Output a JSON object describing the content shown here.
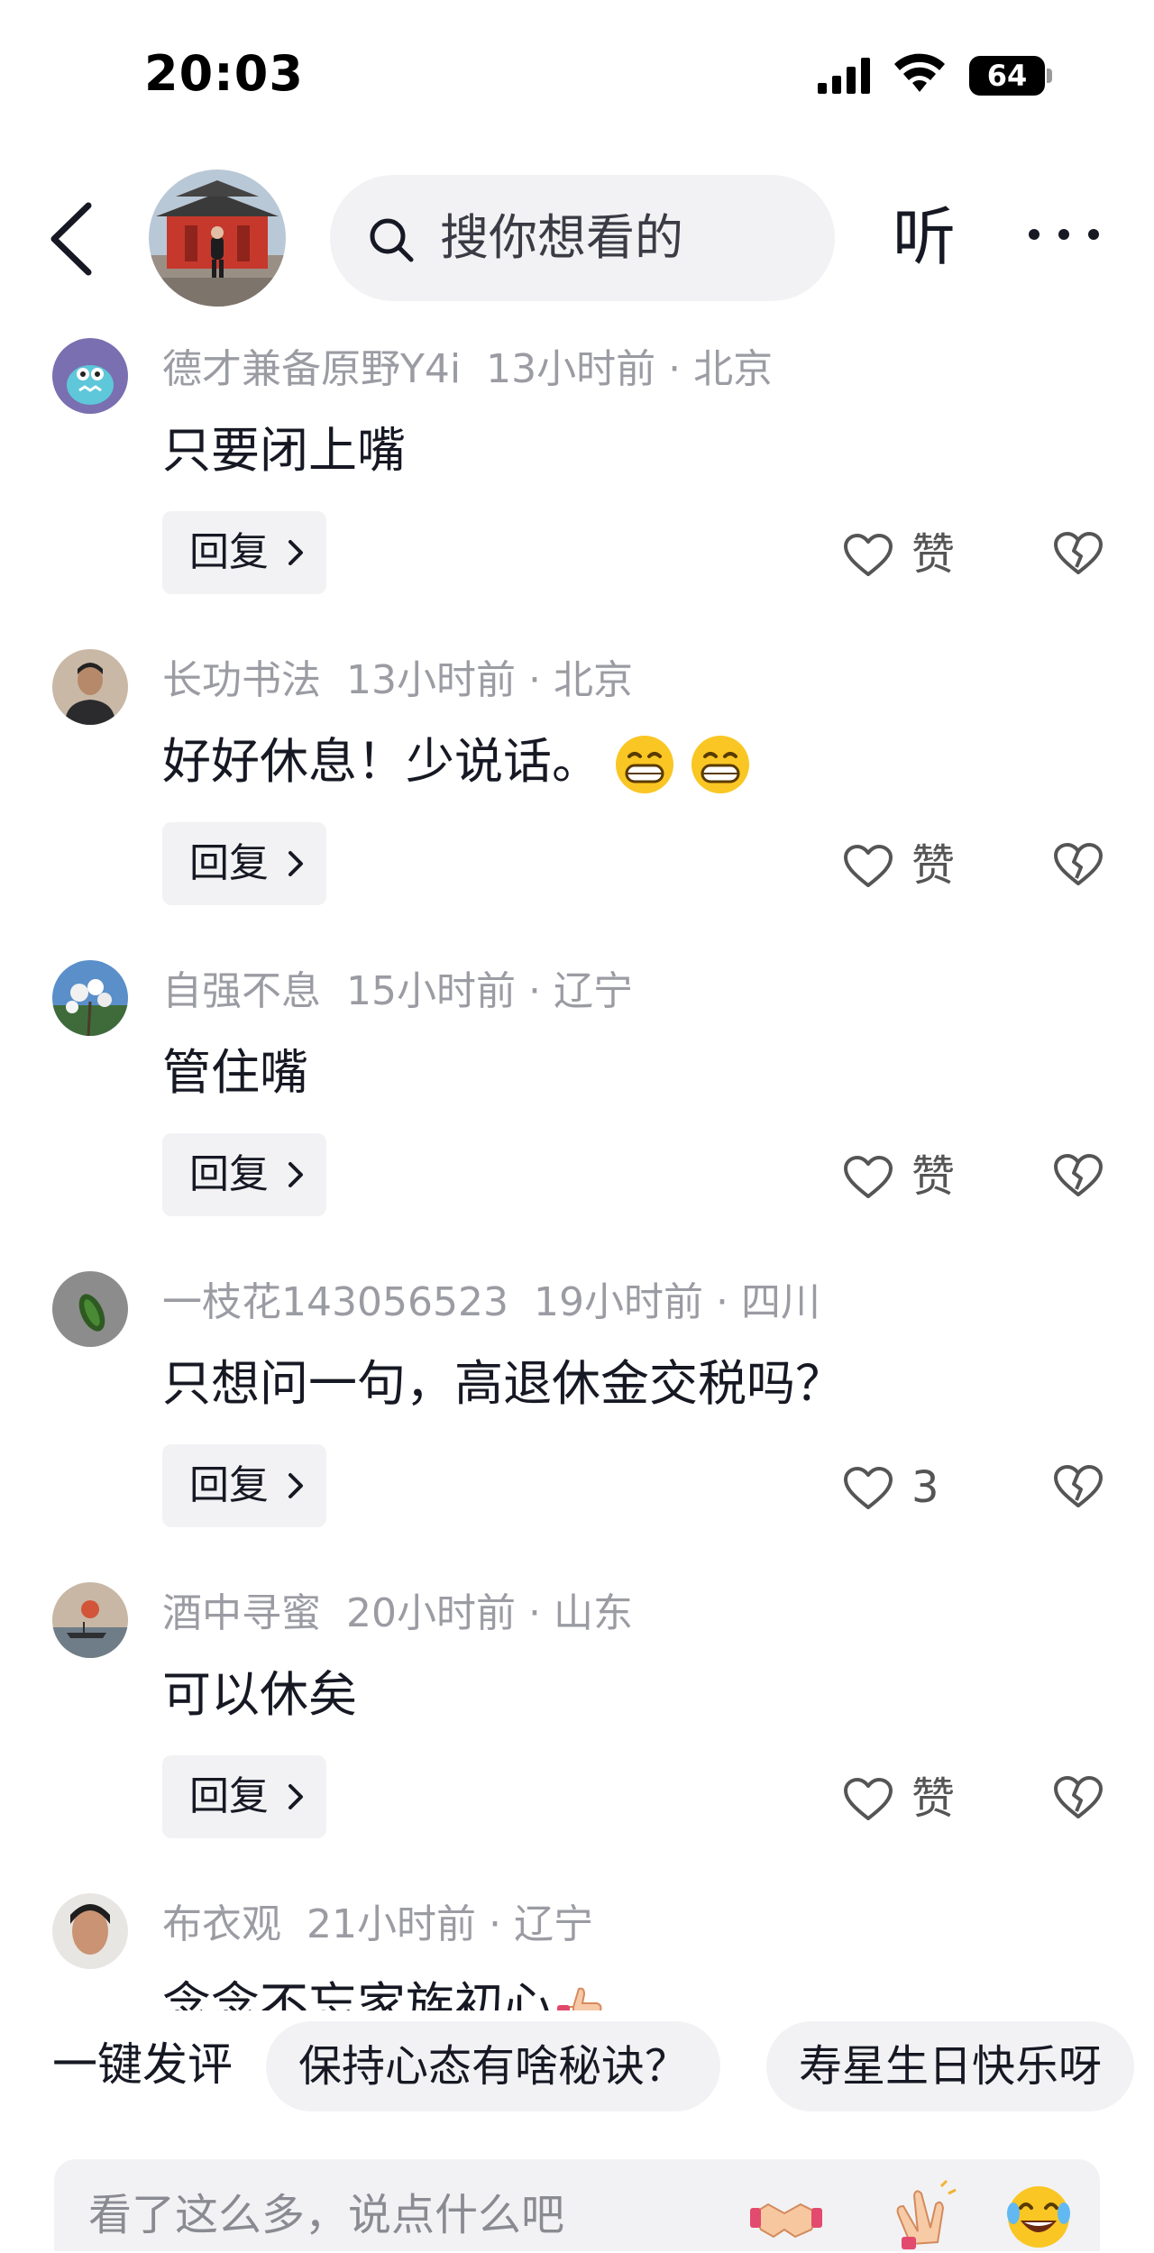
{
  "status": {
    "time": "20:03",
    "battery": "64"
  },
  "header": {
    "search_placeholder": "搜你想看的",
    "listen_label": "听"
  },
  "comments": [
    {
      "name": "德才兼备原野Y4i",
      "time": "13小时前",
      "location": "北京",
      "text": "只要闭上嘴",
      "like_label": "赞",
      "reply_label": "回复"
    },
    {
      "name": "长功书法",
      "time": "13小时前",
      "location": "北京",
      "text": "好好休息！少说话。",
      "like_label": "赞",
      "reply_label": "回复"
    },
    {
      "name": "自强不息",
      "time": "15小时前",
      "location": "辽宁",
      "text": "管住嘴",
      "like_label": "赞",
      "reply_label": "回复"
    },
    {
      "name": "一枝花143056523",
      "time": "19小时前",
      "location": "四川",
      "text": "只想问一句，高退休金交税吗？",
      "like_label": "3",
      "reply_label": "回复"
    },
    {
      "name": "酒中寻蜜",
      "time": "20小时前",
      "location": "山东",
      "text": "可以休矣",
      "like_label": "赞",
      "reply_label": "回复"
    },
    {
      "name": "布衣观",
      "time": "21小时前",
      "location": "辽宁",
      "text": "念念不忘家族初心"
    }
  ],
  "meta_separator": "·",
  "quick_comment": {
    "label": "一键发评",
    "chips": [
      "保持心态有啥秘诀？",
      "寿星生日快乐呀"
    ]
  },
  "input": {
    "placeholder": "看了这么多，说点什么吧"
  },
  "colors": {
    "text_primary": "#161823",
    "text_secondary": "#9b9ca3",
    "chip_bg": "#f2f2f4"
  },
  "icons": [
    "back-arrow-icon",
    "search-icon",
    "more-icon",
    "heart-icon",
    "broken-heart-icon",
    "chevron-right-icon",
    "grin-emoji-icon",
    "thumbs-up-emoji-icon",
    "handshake-emoji-icon",
    "clap-emoji-icon",
    "laugh-cry-emoji-icon"
  ]
}
